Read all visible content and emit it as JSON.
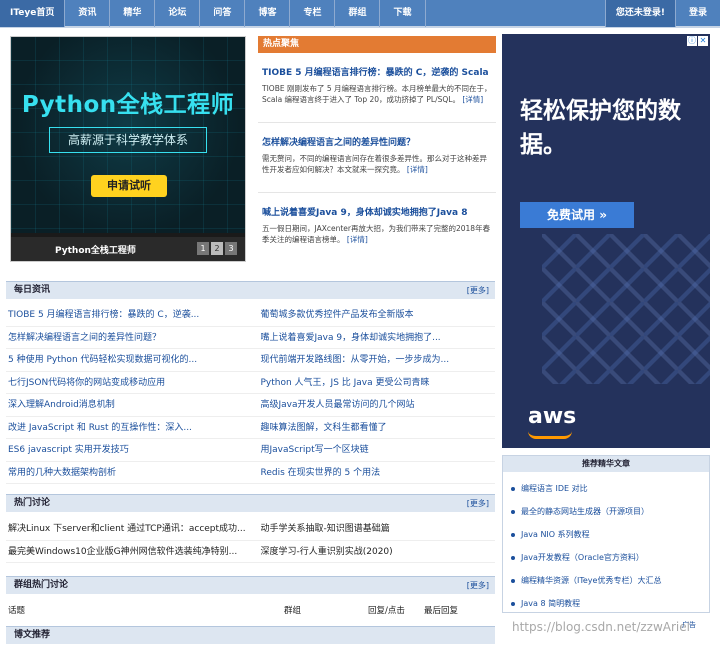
{
  "nav": {
    "items": [
      "ITeye首页",
      "资讯",
      "精华",
      "论坛",
      "问答",
      "博客",
      "专栏",
      "群组",
      "下载"
    ],
    "login_prompt": "您还未登录!",
    "login": "登录"
  },
  "banner": {
    "title": "Python全栈工程师",
    "subtitle": "高薪源于科学教学体系",
    "cta": "申请试听",
    "caption": "Python全栈工程师",
    "pages": [
      "1",
      "2",
      "3"
    ]
  },
  "hot": {
    "header": "热点聚焦",
    "stories": [
      {
        "title": "TIOBE 5 月编程语言排行榜：暴跌的 C，逆袭的 Scala",
        "desc": "TIOBE 刚刚发布了 5 月编程语言排行榜。本月榜单最大的不同在于，Scala 编程语言终于进入了 Top 20，成功挤掉了 PL/SQL。",
        "more": "[详情]"
      },
      {
        "title": "怎样解决编程语言之间的差异性问题？",
        "desc": "需无赘问，不同的编程语言间存在着很多差异性。那么对于这种差异性开发者应如何解决？本文就来一探究竟。",
        "more": "[详情]"
      },
      {
        "title": "喊上说着喜爱Java 9，身体却诚实地拥抱了Java 8",
        "desc": "五一假日期间，JAXcenter再放大招，为我们带来了完整的2018年春季关注的编程语言榜单。",
        "more": "[详情]"
      }
    ]
  },
  "ad": {
    "close_a": "ⓘ",
    "close_b": "✕",
    "headline": "轻松保护您的数据。",
    "button": "免费试用 »",
    "brand": "aws"
  },
  "daily": {
    "header": "每日资讯",
    "more": "[更多]",
    "rows": [
      [
        "TIOBE 5 月编程语言排行榜：暴跌的 C，逆袭...",
        "葡萄城多款优秀控件产品发布全新版本"
      ],
      [
        "怎样解决编程语言之间的差异性问题？",
        "嘴上说着喜爱Java 9，身体却诚实地拥抱了..."
      ],
      [
        "5 种使用 Python 代码轻松实现数据可视化的...",
        "现代前端开发路线图：从零开始，一步步成为..."
      ],
      [
        "七行JSON代码将你的网站变成移动应用",
        "Python 人气王，JS 比 Java 更受公司青睐"
      ],
      [
        "深入理解Android消息机制",
        "高级Java开发人员最常访问的几个网站"
      ],
      [
        "改进 JavaScript 和 Rust 的互操作性：深入...",
        "趣味算法图解，文科生都看懂了"
      ],
      [
        "ES6 javascript 实用开发技巧",
        "用JavaScript写一个区块链"
      ],
      [
        "常用的几种大数据架构剖析",
        "Redis 在现实世界的 5 个用法"
      ]
    ]
  },
  "forum": {
    "header": "热门讨论",
    "more": "[更多]",
    "rows": [
      [
        "解决Linux 下server和client 通过TCP通讯：accept成功...",
        "动手学关系抽取-知识图谱基础篇"
      ],
      [
        "最完美Windows10企业版G神州网信软件选装纯净特别...",
        "深度学习-行人重识别实战(2020)"
      ]
    ]
  },
  "group": {
    "header": "群组热门讨论",
    "more": "[更多]",
    "columns": [
      "话题",
      "群组",
      "回复/点击",
      "最后回复"
    ]
  },
  "blog": {
    "header": "博文推荐"
  },
  "recommended": {
    "header": "推荐精华文章",
    "items": [
      "编程语言 IDE 对比",
      "最全的静态网站生成器（开源项目）",
      "Java NIO 系列教程",
      "Java开发教程（Oracle官方资料）",
      "编程精华资源（ITeye优秀专栏）大汇总",
      "Java 8 简明教程"
    ]
  },
  "ad_label": "广告",
  "watermark": "https://blog.csdn.net/zzwAriel"
}
